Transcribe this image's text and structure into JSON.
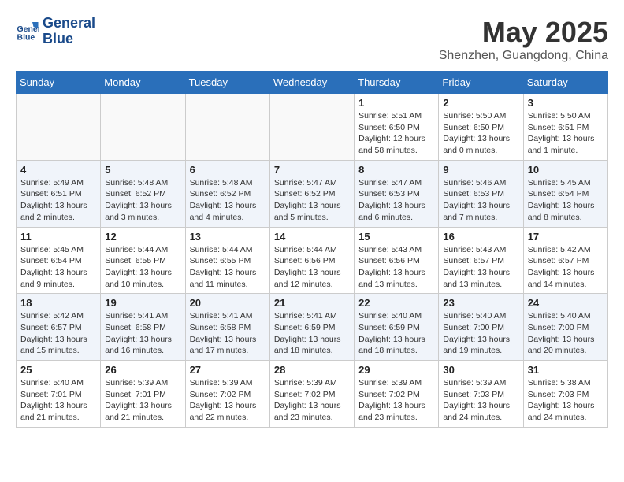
{
  "logo": {
    "line1": "General",
    "line2": "Blue"
  },
  "title": "May 2025",
  "subtitle": "Shenzhen, Guangdong, China",
  "days_of_week": [
    "Sunday",
    "Monday",
    "Tuesday",
    "Wednesday",
    "Thursday",
    "Friday",
    "Saturday"
  ],
  "weeks": [
    [
      {
        "day": "",
        "info": ""
      },
      {
        "day": "",
        "info": ""
      },
      {
        "day": "",
        "info": ""
      },
      {
        "day": "",
        "info": ""
      },
      {
        "day": "1",
        "info": "Sunrise: 5:51 AM\nSunset: 6:50 PM\nDaylight: 12 hours\nand 58 minutes."
      },
      {
        "day": "2",
        "info": "Sunrise: 5:50 AM\nSunset: 6:50 PM\nDaylight: 13 hours\nand 0 minutes."
      },
      {
        "day": "3",
        "info": "Sunrise: 5:50 AM\nSunset: 6:51 PM\nDaylight: 13 hours\nand 1 minute."
      }
    ],
    [
      {
        "day": "4",
        "info": "Sunrise: 5:49 AM\nSunset: 6:51 PM\nDaylight: 13 hours\nand 2 minutes."
      },
      {
        "day": "5",
        "info": "Sunrise: 5:48 AM\nSunset: 6:52 PM\nDaylight: 13 hours\nand 3 minutes."
      },
      {
        "day": "6",
        "info": "Sunrise: 5:48 AM\nSunset: 6:52 PM\nDaylight: 13 hours\nand 4 minutes."
      },
      {
        "day": "7",
        "info": "Sunrise: 5:47 AM\nSunset: 6:52 PM\nDaylight: 13 hours\nand 5 minutes."
      },
      {
        "day": "8",
        "info": "Sunrise: 5:47 AM\nSunset: 6:53 PM\nDaylight: 13 hours\nand 6 minutes."
      },
      {
        "day": "9",
        "info": "Sunrise: 5:46 AM\nSunset: 6:53 PM\nDaylight: 13 hours\nand 7 minutes."
      },
      {
        "day": "10",
        "info": "Sunrise: 5:45 AM\nSunset: 6:54 PM\nDaylight: 13 hours\nand 8 minutes."
      }
    ],
    [
      {
        "day": "11",
        "info": "Sunrise: 5:45 AM\nSunset: 6:54 PM\nDaylight: 13 hours\nand 9 minutes."
      },
      {
        "day": "12",
        "info": "Sunrise: 5:44 AM\nSunset: 6:55 PM\nDaylight: 13 hours\nand 10 minutes."
      },
      {
        "day": "13",
        "info": "Sunrise: 5:44 AM\nSunset: 6:55 PM\nDaylight: 13 hours\nand 11 minutes."
      },
      {
        "day": "14",
        "info": "Sunrise: 5:44 AM\nSunset: 6:56 PM\nDaylight: 13 hours\nand 12 minutes."
      },
      {
        "day": "15",
        "info": "Sunrise: 5:43 AM\nSunset: 6:56 PM\nDaylight: 13 hours\nand 13 minutes."
      },
      {
        "day": "16",
        "info": "Sunrise: 5:43 AM\nSunset: 6:57 PM\nDaylight: 13 hours\nand 13 minutes."
      },
      {
        "day": "17",
        "info": "Sunrise: 5:42 AM\nSunset: 6:57 PM\nDaylight: 13 hours\nand 14 minutes."
      }
    ],
    [
      {
        "day": "18",
        "info": "Sunrise: 5:42 AM\nSunset: 6:57 PM\nDaylight: 13 hours\nand 15 minutes."
      },
      {
        "day": "19",
        "info": "Sunrise: 5:41 AM\nSunset: 6:58 PM\nDaylight: 13 hours\nand 16 minutes."
      },
      {
        "day": "20",
        "info": "Sunrise: 5:41 AM\nSunset: 6:58 PM\nDaylight: 13 hours\nand 17 minutes."
      },
      {
        "day": "21",
        "info": "Sunrise: 5:41 AM\nSunset: 6:59 PM\nDaylight: 13 hours\nand 18 minutes."
      },
      {
        "day": "22",
        "info": "Sunrise: 5:40 AM\nSunset: 6:59 PM\nDaylight: 13 hours\nand 18 minutes."
      },
      {
        "day": "23",
        "info": "Sunrise: 5:40 AM\nSunset: 7:00 PM\nDaylight: 13 hours\nand 19 minutes."
      },
      {
        "day": "24",
        "info": "Sunrise: 5:40 AM\nSunset: 7:00 PM\nDaylight: 13 hours\nand 20 minutes."
      }
    ],
    [
      {
        "day": "25",
        "info": "Sunrise: 5:40 AM\nSunset: 7:01 PM\nDaylight: 13 hours\nand 21 minutes."
      },
      {
        "day": "26",
        "info": "Sunrise: 5:39 AM\nSunset: 7:01 PM\nDaylight: 13 hours\nand 21 minutes."
      },
      {
        "day": "27",
        "info": "Sunrise: 5:39 AM\nSunset: 7:02 PM\nDaylight: 13 hours\nand 22 minutes."
      },
      {
        "day": "28",
        "info": "Sunrise: 5:39 AM\nSunset: 7:02 PM\nDaylight: 13 hours\nand 23 minutes."
      },
      {
        "day": "29",
        "info": "Sunrise: 5:39 AM\nSunset: 7:02 PM\nDaylight: 13 hours\nand 23 minutes."
      },
      {
        "day": "30",
        "info": "Sunrise: 5:39 AM\nSunset: 7:03 PM\nDaylight: 13 hours\nand 24 minutes."
      },
      {
        "day": "31",
        "info": "Sunrise: 5:38 AM\nSunset: 7:03 PM\nDaylight: 13 hours\nand 24 minutes."
      }
    ]
  ]
}
